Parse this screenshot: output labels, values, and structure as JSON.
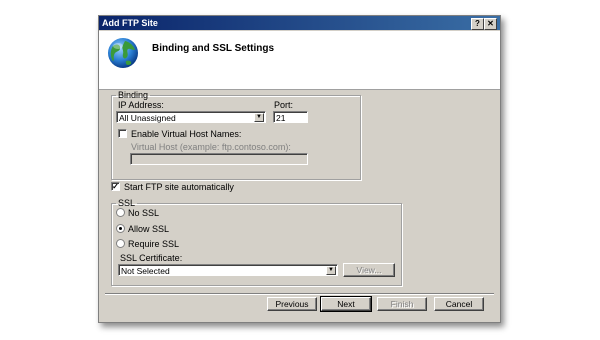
{
  "window": {
    "title": "Add FTP Site",
    "help_label": "?",
    "close_label": "✕"
  },
  "header": {
    "title": "Binding and SSL Settings",
    "icon": "globe-icon"
  },
  "binding": {
    "legend": "Binding",
    "ip_label": "IP Address:",
    "ip_value": "All Unassigned",
    "port_label": "Port:",
    "port_value": "21",
    "virtual_host_checkbox_label": "Enable Virtual Host Names:",
    "virtual_host_checked": false,
    "virtual_host_label": "Virtual Host (example: ftp.contoso.com):",
    "virtual_host_value": ""
  },
  "start_auto": {
    "label": "Start FTP site automatically",
    "checked": true
  },
  "ssl": {
    "legend": "SSL",
    "options": [
      {
        "label": "No SSL",
        "selected": false
      },
      {
        "label": "Allow SSL",
        "selected": true
      },
      {
        "label": "Require SSL",
        "selected": false
      }
    ],
    "cert_label": "SSL Certificate:",
    "cert_value": "Not Selected",
    "view_label": "View..."
  },
  "footer": {
    "previous_label": "Previous",
    "next_label": "Next",
    "finish_label": "Finish",
    "cancel_label": "Cancel"
  }
}
